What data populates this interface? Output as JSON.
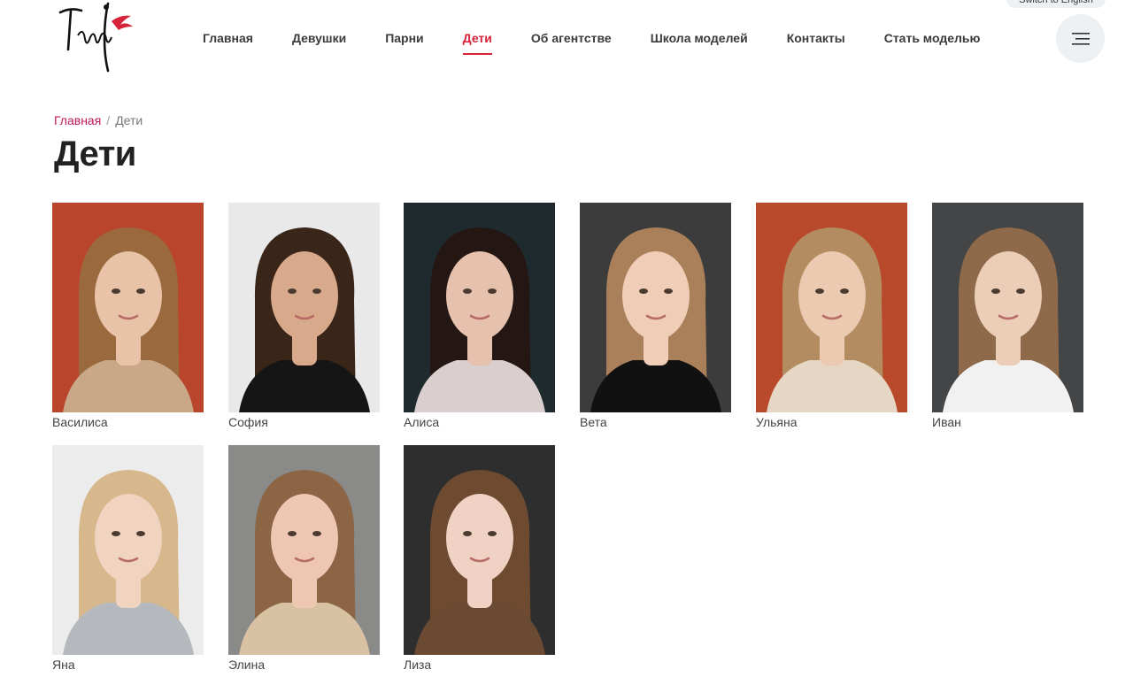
{
  "header": {
    "logo_text": "Тамара",
    "lang_switch": "Switch to English",
    "nav": [
      {
        "label": "Главная",
        "active": false
      },
      {
        "label": "Девушки",
        "active": false
      },
      {
        "label": "Парни",
        "active": false
      },
      {
        "label": "Дети",
        "active": true
      },
      {
        "label": "Об агентстве",
        "active": false
      },
      {
        "label": "Школа моделей",
        "active": false
      },
      {
        "label": "Контакты",
        "active": false
      },
      {
        "label": "Стать моделью",
        "active": false
      }
    ],
    "menu_icon": "hamburger-icon"
  },
  "breadcrumb": {
    "home": "Главная",
    "separator": "/",
    "current": "Дети"
  },
  "page_title": "Дети",
  "colors": {
    "accent": "#d6243a",
    "breadcrumb_link": "#c2185b",
    "button_bg": "#eef1f4"
  },
  "models": [
    {
      "name": "Василиса",
      "bg": "#b9452d",
      "hair": "#9a6a3e",
      "skin": "#e8c3a8",
      "top": "#c9a888"
    },
    {
      "name": "София",
      "bg": "#e9e9e9",
      "hair": "#3a2519",
      "skin": "#d8a98a",
      "top": "#151515"
    },
    {
      "name": "Алиса",
      "bg": "#1e2a2e",
      "hair": "#241713",
      "skin": "#e6c2ae",
      "top": "#d9cfcf"
    },
    {
      "name": "Вета",
      "bg": "#3c3c3c",
      "hair": "#a9805a",
      "skin": "#efcdb6",
      "top": "#111111"
    },
    {
      "name": "Ульяна",
      "bg": "#b84a2b",
      "hair": "#b48c62",
      "skin": "#eccab1",
      "top": "#e6d7c4"
    },
    {
      "name": "Иван",
      "bg": "#434547",
      "hair": "#8e6a4b",
      "skin": "#eccdb8",
      "top": "#f1f1f1"
    },
    {
      "name": "Яна",
      "bg": "#ececec",
      "hair": "#d7b78c",
      "skin": "#f0d4c0",
      "top": "#b5b9bd"
    },
    {
      "name": "Элина",
      "bg": "#8a8a88",
      "hair": "#8c6544",
      "skin": "#edc7b2",
      "top": "#d9c1a4"
    },
    {
      "name": "Лиза",
      "bg": "#2e2e2e",
      "hair": "#6e4a30",
      "skin": "#f0d2c4",
      "top": "#6b4a34"
    }
  ]
}
